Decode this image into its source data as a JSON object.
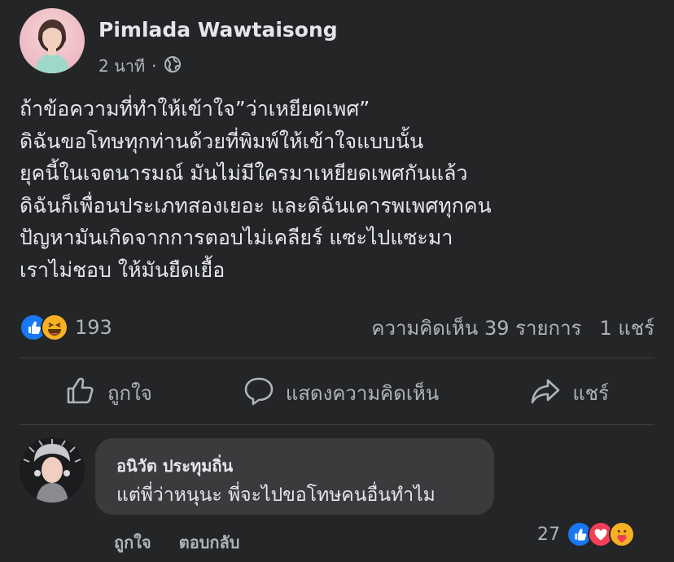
{
  "post": {
    "author": "Pimlada Wawtaisong",
    "time": "2 นาที",
    "separator": "·",
    "lines": [
      "ถ้าข้อความที่ทำให้เข้าใจ”ว่าเหยียดเพศ”",
      "ดิฉันขอโทษทุกท่านด้วยที่พิมพ์ให้เข้าใจแบบนั้น",
      "ยุคนี้ในเจตนารมณ์ มันไม่มีใครมาเหยียดเพศกันแล้ว",
      "ดิฉันก็เพื่อนประเภทสองเยอะ และดิฉันเคารพเพศทุกคน",
      "ปัญหามันเกิดจากการตอบไม่เคลียร์ แซะไปแซะมา",
      "เราไม่ชอบ ให้มันยืดเยื้อ"
    ]
  },
  "reactions": {
    "count": "193",
    "comments": "ความคิดเห็น 39 รายการ",
    "shares": "1 แชร์"
  },
  "actions": {
    "like": "ถูกใจ",
    "comment": "แสดงความคิดเห็น",
    "share": "แชร์"
  },
  "comment": {
    "author": "อนิวัต ประทุมถิ่น",
    "text": "แต่พี่ว่าหนุนะ พี่จะไปขอโทษคนอื่นทำไม",
    "like_label": "ถูกใจ",
    "reply_label": "ตอบกลับ",
    "reaction_count": "27"
  },
  "colors": {
    "background": "#242526",
    "like_blue": "#1877f2",
    "love_red": "#f33e58",
    "haha_yellow": "#f7b125"
  },
  "icons": [
    "globe-icon",
    "like-reaction-icon",
    "haha-reaction-icon",
    "love-reaction-icon",
    "care-reaction-icon",
    "thumbs-up-icon",
    "comment-bubble-icon",
    "share-arrow-icon"
  ]
}
